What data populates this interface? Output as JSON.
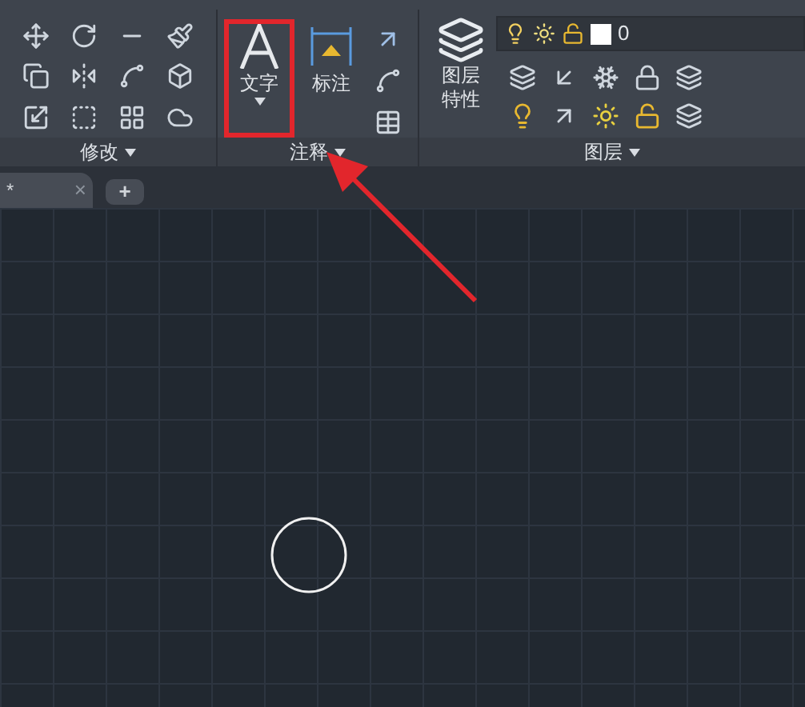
{
  "ribbon": {
    "panels": [
      {
        "kind": "modify",
        "title": "修改"
      },
      {
        "kind": "annotate",
        "title": "注释",
        "buttons": [
          {
            "label": "文字",
            "highlighted": true
          },
          {
            "label": "标注",
            "highlighted": false
          }
        ]
      },
      {
        "kind": "layers",
        "title": "图层",
        "button_lines": [
          "图层",
          "特性"
        ],
        "current_layer": "0"
      }
    ]
  },
  "file_tabs": [
    {
      "label": "*",
      "close": "×",
      "selected": true
    }
  ],
  "new_tab": "+"
}
